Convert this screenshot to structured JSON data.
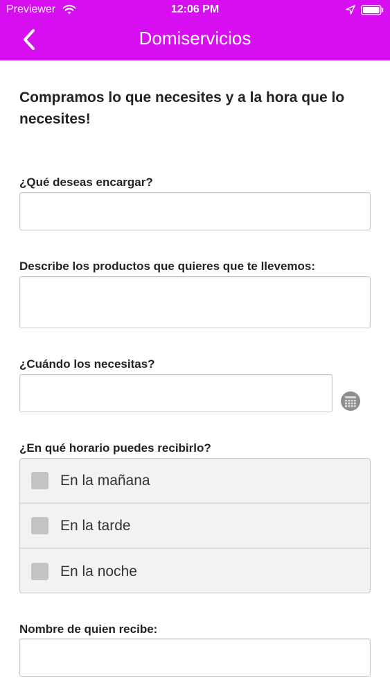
{
  "status_bar": {
    "carrier": "Previewer",
    "time": "12:06 PM",
    "icons": [
      "wifi-icon",
      "location-icon",
      "battery-icon"
    ]
  },
  "nav": {
    "title": "Domiservicios",
    "back_icon": "chevron-left-icon"
  },
  "colors": {
    "header": "#d60ef0",
    "text": "#222222",
    "input_border": "#c8c8c8",
    "option_bg": "#f2f2f2",
    "checkbox": "#c3c3c3"
  },
  "form": {
    "intro": "Compramos lo que necesites y a la hora que lo necesites!",
    "order_label": "¿Qué deseas encargar?",
    "order_value": "",
    "description_label": "Describe los productos que quieres que te llevemos:",
    "description_value": "",
    "when_label": "¿Cuándo los necesitas?",
    "when_value": "",
    "when_icon": "calendar-icon",
    "schedule_label": "¿En qué horario puedes recibirlo?",
    "schedule_options": [
      {
        "label": "En la mañana",
        "checked": false
      },
      {
        "label": "En la tarde",
        "checked": false
      },
      {
        "label": "En la noche",
        "checked": false
      }
    ],
    "receiver_label": "Nombre de quien recibe:",
    "receiver_value": ""
  }
}
